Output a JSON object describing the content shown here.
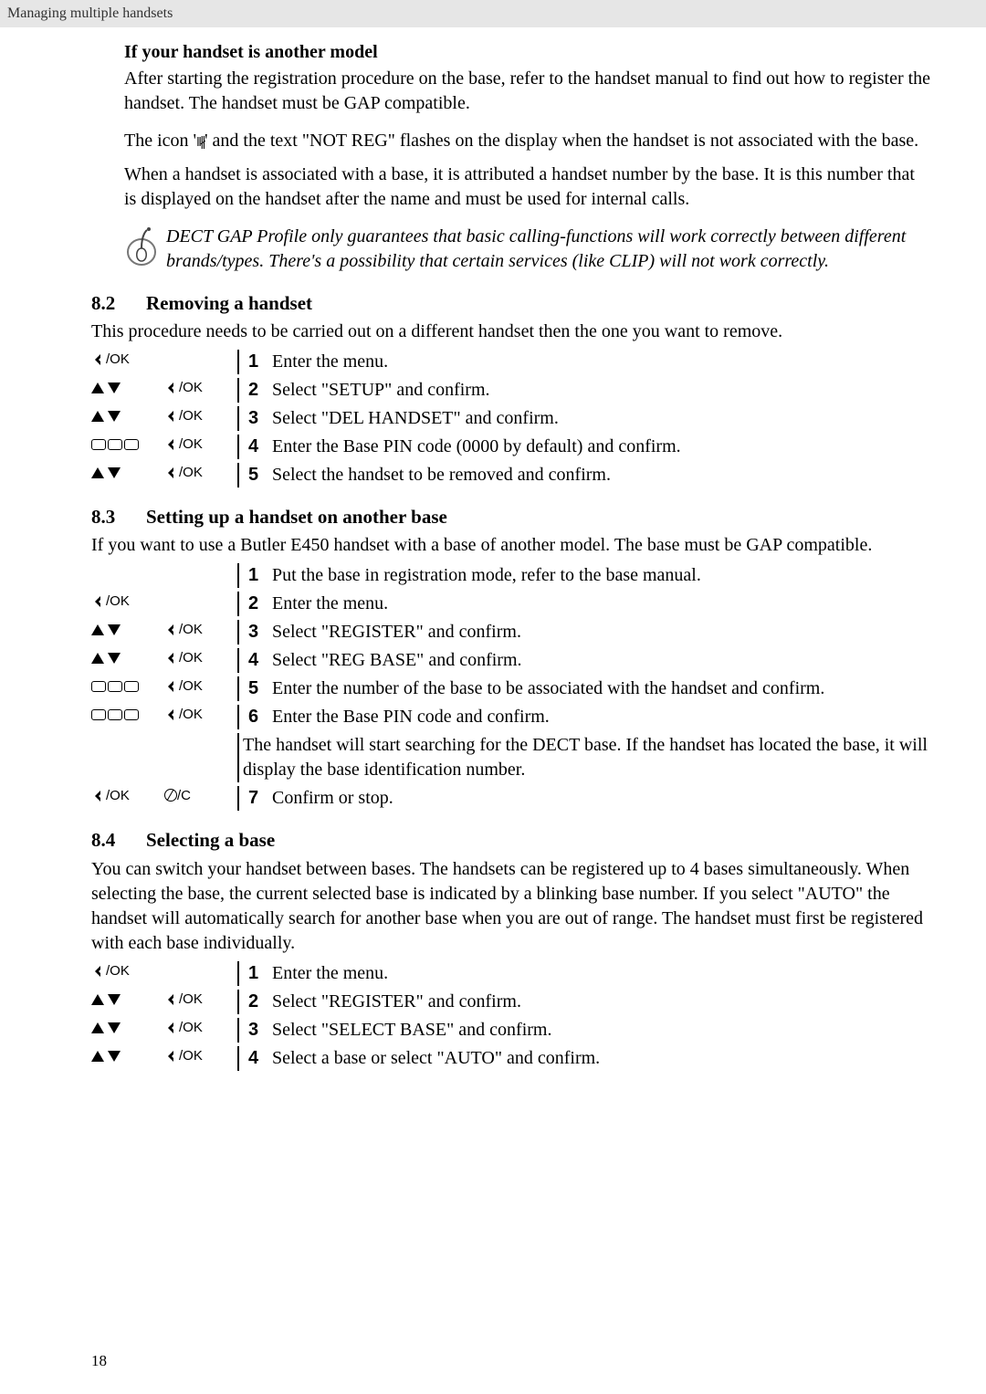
{
  "header": {
    "running_head": "Managing multiple handsets"
  },
  "intro_block": {
    "sub_heading": "If your handset is another model",
    "p1": "After starting the registration procedure on the base, refer to the handset manual to find out how to register the handset. The handset must be GAP compatible.",
    "p2_pre": "The icon '",
    "p2_post": "' and the text \"NOT REG\" flashes on the display when the handset is not associated with the base.",
    "p3": "When a handset is associated with a base, it is attributed a handset number by the base. It is this number that is displayed on the handset after the name and must be used for internal calls.",
    "note": "DECT GAP Profile only guarantees that basic calling-functions will work correctly between different brands/types. There's a possibility that certain services (like CLIP) will not work correctly."
  },
  "keys": {
    "ok_label": "/OK",
    "cancel_label": "/C"
  },
  "section82": {
    "number": "8.2",
    "title": "Removing a handset",
    "intro": "This procedure needs to be carried out on a different handset then the one you want to remove.",
    "steps": [
      {
        "n": "1",
        "t": "Enter the menu."
      },
      {
        "n": "2",
        "t": "Select \"SETUP\" and confirm."
      },
      {
        "n": "3",
        "t": "Select \"DEL HANDSET\" and confirm."
      },
      {
        "n": "4",
        "t": "Enter the Base PIN code (0000 by default) and confirm."
      },
      {
        "n": "5",
        "t": "Select the handset to be removed and confirm."
      }
    ]
  },
  "section83": {
    "number": "8.3",
    "title": "Setting up a handset on another base",
    "intro": "If you want to use a Butler E450 handset with a base of another model. The base must be GAP compatible.",
    "steps_a": [
      {
        "n": "1",
        "t": "Put the base in registration mode, refer to the base manual."
      },
      {
        "n": "2",
        "t": "Enter the menu."
      },
      {
        "n": "3",
        "t": "Select \"REGISTER\" and confirm."
      },
      {
        "n": "4",
        "t": "Select \"REG BASE\" and confirm."
      },
      {
        "n": "5",
        "t": "Enter the number of the base to be associated with the handset and confirm."
      },
      {
        "n": "6",
        "t": "Enter the Base PIN code and confirm."
      }
    ],
    "search_text": "The handset will start searching for the DECT base. If the handset has located the base, it will display the base identification number.",
    "step7": {
      "n": "7",
      "t": "Confirm or stop."
    }
  },
  "section84": {
    "number": "8.4",
    "title": "Selecting a base",
    "intro": "You can switch your handset between bases. The handsets can be registered up to 4 bases simultaneously. When selecting the base, the current selected base is indicated by a blinking base number. If you select \"AUTO\" the handset will automatically search for another base when you are out of range. The handset must first be registered with each base individually.",
    "steps": [
      {
        "n": "1",
        "t": "Enter the menu."
      },
      {
        "n": "2",
        "t": "Select \"REGISTER\" and confirm."
      },
      {
        "n": "3",
        "t": "Select \"SELECT BASE\" and confirm."
      },
      {
        "n": "4",
        "t": "Select a base or select \"AUTO\" and confirm."
      }
    ]
  },
  "page_number": "18"
}
